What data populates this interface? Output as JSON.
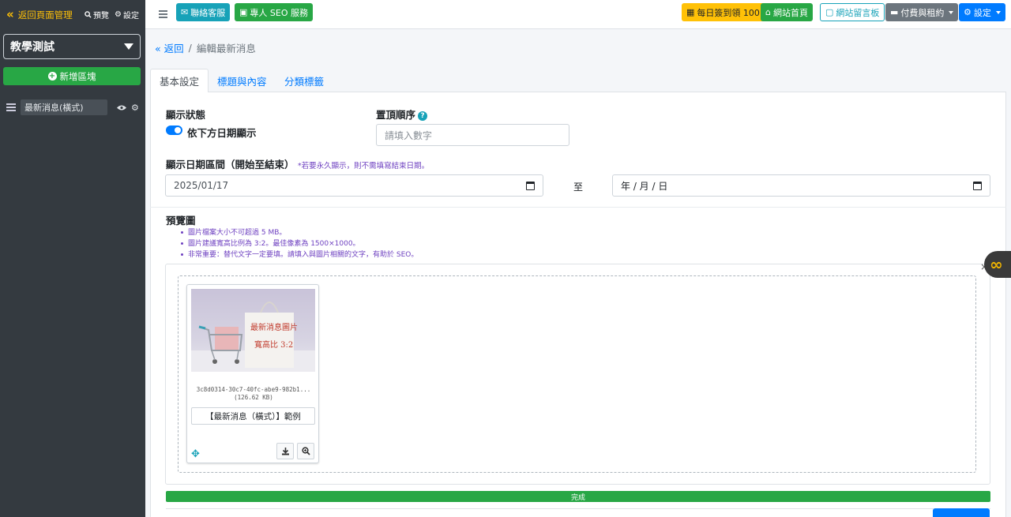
{
  "sidebar": {
    "back_label": "返回頁面管理",
    "preview_label": "預覽",
    "settings_label": "設定",
    "site_select": "教學測試",
    "add_block_label": "新增區塊",
    "items": [
      {
        "label": "最新消息(橫式)"
      }
    ]
  },
  "topbar": {
    "contact_label": "聯絡客服",
    "seo_label": "專人 SEO 服務",
    "checkin_label": "每日簽到領 100",
    "home_label": "網站首頁",
    "board_label": "網站留言板",
    "billing_label": "付費與租約",
    "settings_label": "設定"
  },
  "breadcrumb": {
    "back": "返回",
    "current": "編輯最新消息"
  },
  "tabs": [
    {
      "label": "基本設定"
    },
    {
      "label": "標題與內容"
    },
    {
      "label": "分類標籤"
    }
  ],
  "form": {
    "status_label": "顯示狀態",
    "status_switch_label": "依下方日期顯示",
    "status_on": true,
    "order_label": "置頂順序",
    "order_placeholder": "請填入數字",
    "date_range_label": "顯示日期區間（開始至結束）",
    "date_hint": "*若要永久顯示，則不需填寫結束日期。",
    "start_date": "2025/01/17",
    "to_label": "至",
    "end_date": "年 / 月 / 日"
  },
  "preview": {
    "label": "預覽圖",
    "notes": [
      "圖片檔案大小不可超過 5 MB。",
      "圖片建議寬高比例為 3:2。最佳像素為 1500×1000。",
      "非常重要：替代文字一定要填。請填入與圖片相關的文字，有助於 SEO。"
    ],
    "file": {
      "name": "3c8d0314-30c7-40fc-abe9-982b1...",
      "size": "(126.62 KB)",
      "caption": "【最新消息（橫式）】範例",
      "image_text_1": "最新消息圖片",
      "image_text_2": "寬高比 3:2"
    }
  },
  "progress": {
    "label": "完成",
    "value": 1.0
  },
  "colors": {
    "primary": "#007bff",
    "success": "#28a745",
    "info": "#17a2b8",
    "warning": "#ffc107",
    "sidebar": "#343a40",
    "hint": "#6f42c1"
  }
}
